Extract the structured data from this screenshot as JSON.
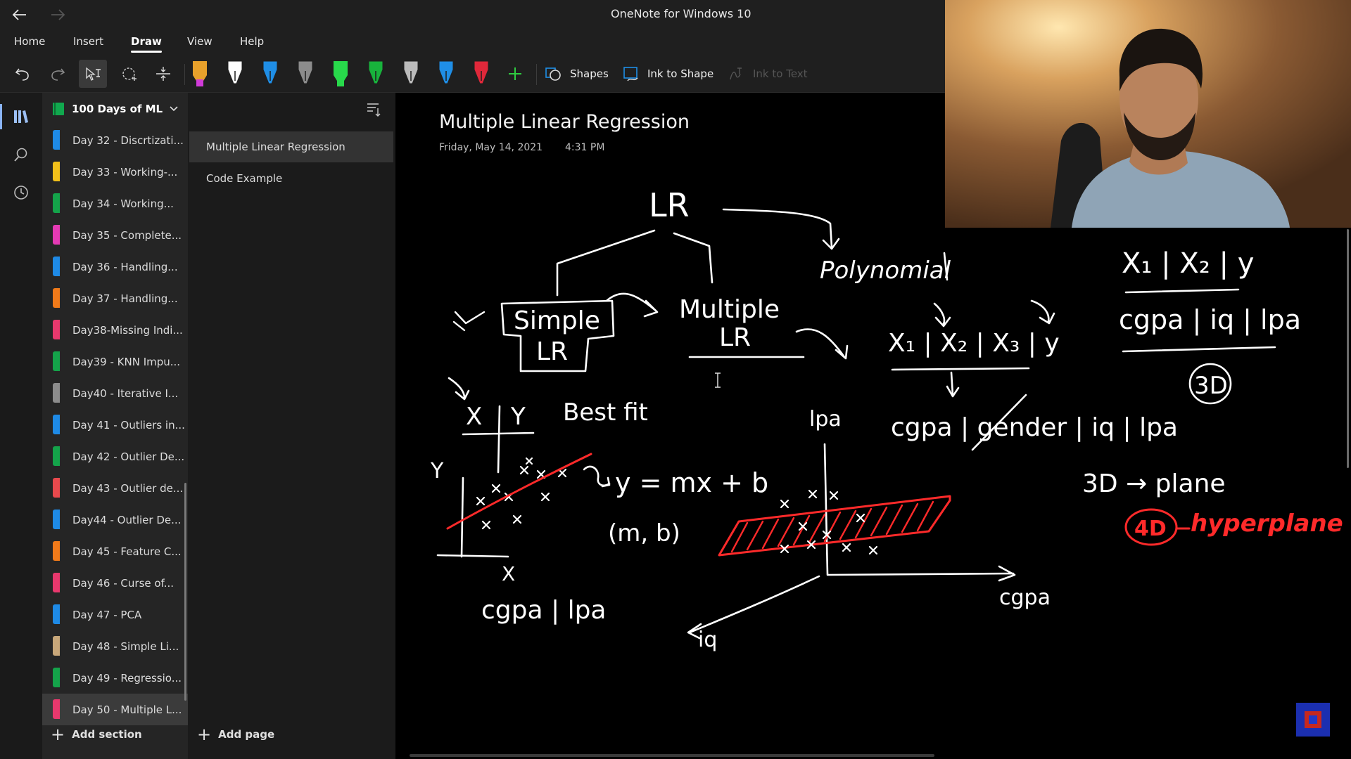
{
  "window": {
    "title": "OneNote for Windows 10"
  },
  "menu": {
    "items": [
      "Home",
      "Insert",
      "Draw",
      "View",
      "Help"
    ],
    "active": "Draw"
  },
  "ribbon": {
    "shapes_label": "Shapes",
    "ink_to_shape_label": "Ink to Shape",
    "ink_to_text_label": "Ink to Text",
    "pens": [
      {
        "color": "#e8a12b",
        "accent": "#d03bd9",
        "type": "highlighter"
      },
      {
        "color": "#ffffff",
        "accent": "#ffffff",
        "type": "pen"
      },
      {
        "color": "#1f8ee6",
        "accent": "#ffffff",
        "type": "pen"
      },
      {
        "color": "#8c8c8c",
        "accent": "#ffffff",
        "type": "pen"
      },
      {
        "color": "#28d94b",
        "accent": "#28d94b",
        "type": "highlighter"
      },
      {
        "color": "#18b33c",
        "accent": "#ffffff",
        "type": "pen"
      },
      {
        "color": "#bbbbbb",
        "accent": "#ffffff",
        "type": "pencil"
      },
      {
        "color": "#1f8ee6",
        "accent": "#ffffff",
        "type": "pen"
      },
      {
        "color": "#e0283a",
        "accent": "#ffffff",
        "type": "pen"
      }
    ]
  },
  "notebook": {
    "name": "100 Days of ML",
    "color": "#11a84e"
  },
  "sections": [
    {
      "label": "Day 32 - Discrtizati...",
      "color": "#1e8ae6"
    },
    {
      "label": "Day 33 - Working-...",
      "color": "#f2c01a"
    },
    {
      "label": "Day 34 - Working...",
      "color": "#14a34a"
    },
    {
      "label": "Day 35 - Complete...",
      "color": "#e53ab4"
    },
    {
      "label": "Day 36 - Handling...",
      "color": "#1e8ae6"
    },
    {
      "label": "Day 37 - Handling...",
      "color": "#f07a1a"
    },
    {
      "label": "Day38-Missing Indi...",
      "color": "#e8386d"
    },
    {
      "label": "Day39 - KNN Impu...",
      "color": "#14a34a"
    },
    {
      "label": "Day40 - Iterative I...",
      "color": "#8c8c8c"
    },
    {
      "label": "Day 41 - Outliers in...",
      "color": "#1e8ae6"
    },
    {
      "label": "Day 42 - Outlier De...",
      "color": "#14a34a"
    },
    {
      "label": "Day 43 - Outlier de...",
      "color": "#e8494d"
    },
    {
      "label": "Day44 - Outlier De...",
      "color": "#1e8ae6"
    },
    {
      "label": "Day 45 - Feature C...",
      "color": "#f07a1a"
    },
    {
      "label": "Day 46 - Curse of...",
      "color": "#e8386d"
    },
    {
      "label": "Day 47 - PCA",
      "color": "#1e8ae6"
    },
    {
      "label": "Day 48 - Simple Li...",
      "color": "#c8a77a"
    },
    {
      "label": "Day 49 - Regressio...",
      "color": "#14a34a"
    },
    {
      "label": "Day 50 - Multiple L...",
      "color": "#e8386d",
      "selected": true
    }
  ],
  "pages": [
    {
      "label": "Multiple Linear Regression",
      "selected": true
    },
    {
      "label": "Code Example"
    }
  ],
  "footer": {
    "add_section": "Add section",
    "add_page": "Add page"
  },
  "note": {
    "title": "Multiple Linear Regression",
    "date": "Friday, May 14, 2021",
    "time": "4:31 PM"
  },
  "ink": {
    "white": "#ffffff",
    "red": "#ff2a2a",
    "texts": {
      "lr": "LR",
      "polynomial": "Polynomial",
      "simple": "Simple",
      "simple_lr": "LR",
      "multiple": "Multiple",
      "multiple_lr": "LR",
      "header1": "X₁ | X₂ | X₃ | y",
      "table_top": "X₁ | X₂ | y",
      "table_bottom": "cgpa | iq | lpa",
      "three_d": "3D",
      "best_fit": "Best fit",
      "xy_x": "X",
      "xy_y": "Y",
      "axis_y": "Y",
      "axis_x": "X",
      "equation": "y = mx + b",
      "params": "(m, b)",
      "cgpa_lpa": "cgpa | lpa",
      "lpa_axis": "lpa",
      "feature_row": "cgpa | gender | iq | lpa",
      "plane_rule": "3D → plane",
      "four_d": "4D",
      "hyperplane": "hyperplane",
      "cgpa_axis": "cgpa",
      "iq_axis": "iq"
    }
  }
}
